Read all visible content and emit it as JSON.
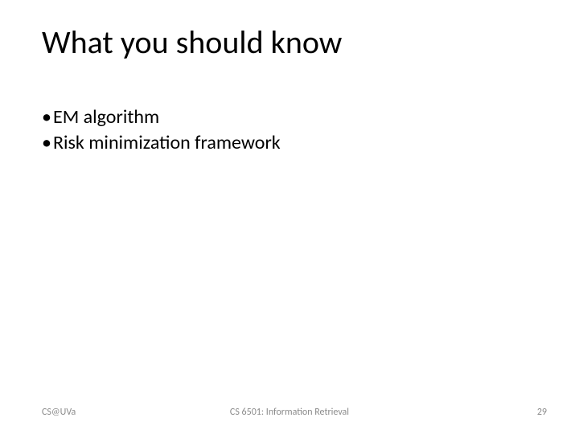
{
  "slide": {
    "title": "What you should know",
    "bullets": [
      "EM algorithm",
      "Risk minimization framework"
    ],
    "footer": {
      "left": "CS@UVa",
      "center": "CS 6501: Information Retrieval",
      "page": "29"
    }
  }
}
